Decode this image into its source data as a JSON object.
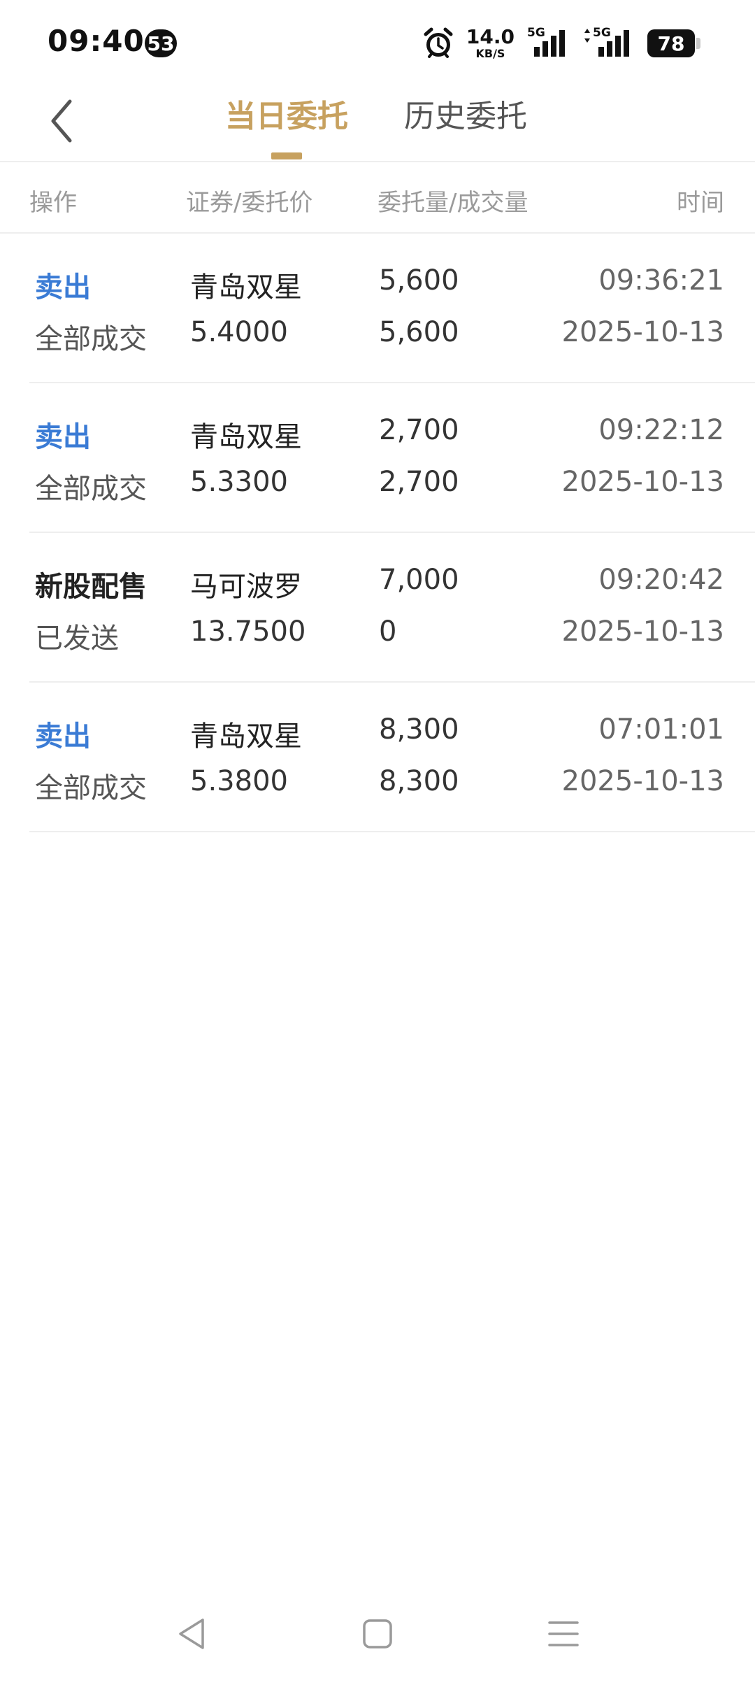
{
  "status_bar": {
    "time": "09:40",
    "notification_count": "53",
    "net_speed_value": "14.0",
    "net_speed_unit": "KB/S",
    "signal1_label": "5G",
    "signal2_label": "5G",
    "battery_level": "78"
  },
  "header": {
    "tabs": [
      {
        "label": "当日委托",
        "active": true
      },
      {
        "label": "历史委托",
        "active": false
      }
    ]
  },
  "table": {
    "columns": [
      "操作",
      "证券/委托价",
      "委托量/成交量",
      "时间"
    ],
    "rows": [
      {
        "operation": "卖出",
        "status": "全部成交",
        "security": "青岛双星",
        "price": "5.4000",
        "order_qty": "5,600",
        "filled_qty": "5,600",
        "time": "09:36:21",
        "date": "2025-10-13"
      },
      {
        "operation": "卖出",
        "status": "全部成交",
        "security": "青岛双星",
        "price": "5.3300",
        "order_qty": "2,700",
        "filled_qty": "2,700",
        "time": "09:22:12",
        "date": "2025-10-13"
      },
      {
        "operation": "新股配售",
        "status": "已发送",
        "security": "马可波罗",
        "price": "13.7500",
        "order_qty": "7,000",
        "filled_qty": "0",
        "time": "09:20:42",
        "date": "2025-10-13"
      },
      {
        "operation": "卖出",
        "status": "全部成交",
        "security": "青岛双星",
        "price": "5.3800",
        "order_qty": "8,300",
        "filled_qty": "8,300",
        "time": "07:01:01",
        "date": "2025-10-13"
      }
    ]
  },
  "colors": {
    "accent_gold": "#c7a15f",
    "sell_blue": "#3a7bd5"
  }
}
